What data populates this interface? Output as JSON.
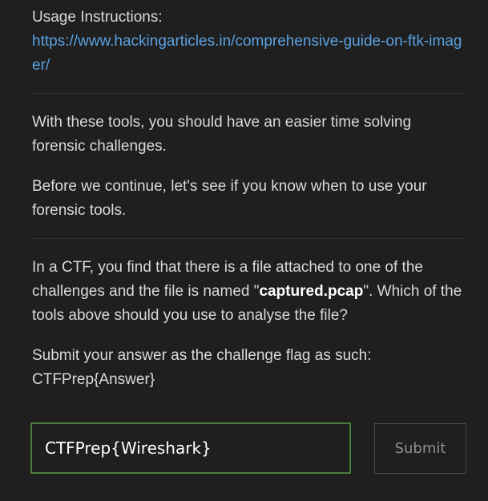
{
  "usage": {
    "label": "Usage Instructions:",
    "link_text": "https://www.hackingarticles.in/comprehensive-guide-on-ftk-imager/"
  },
  "intro": {
    "p1": "With these tools, you should have an easier time solving forensic challenges.",
    "p2": "Before we continue, let's see if you know when to use your forensic tools."
  },
  "question": {
    "before": "In a CTF, you find that there is a file attached to one of the challenges and the file is named \"",
    "filename": "captured.pcap",
    "after": "\". Which of the tools above should you use to analyse the file?",
    "instructions_line1": "Submit your answer as the challenge flag as such:",
    "instructions_line2": "CTFPrep{Answer}"
  },
  "form": {
    "answer_value": "CTFPrep{Wireshark}",
    "submit_label": "Submit",
    "input_border_color": "#4a7c3a"
  }
}
